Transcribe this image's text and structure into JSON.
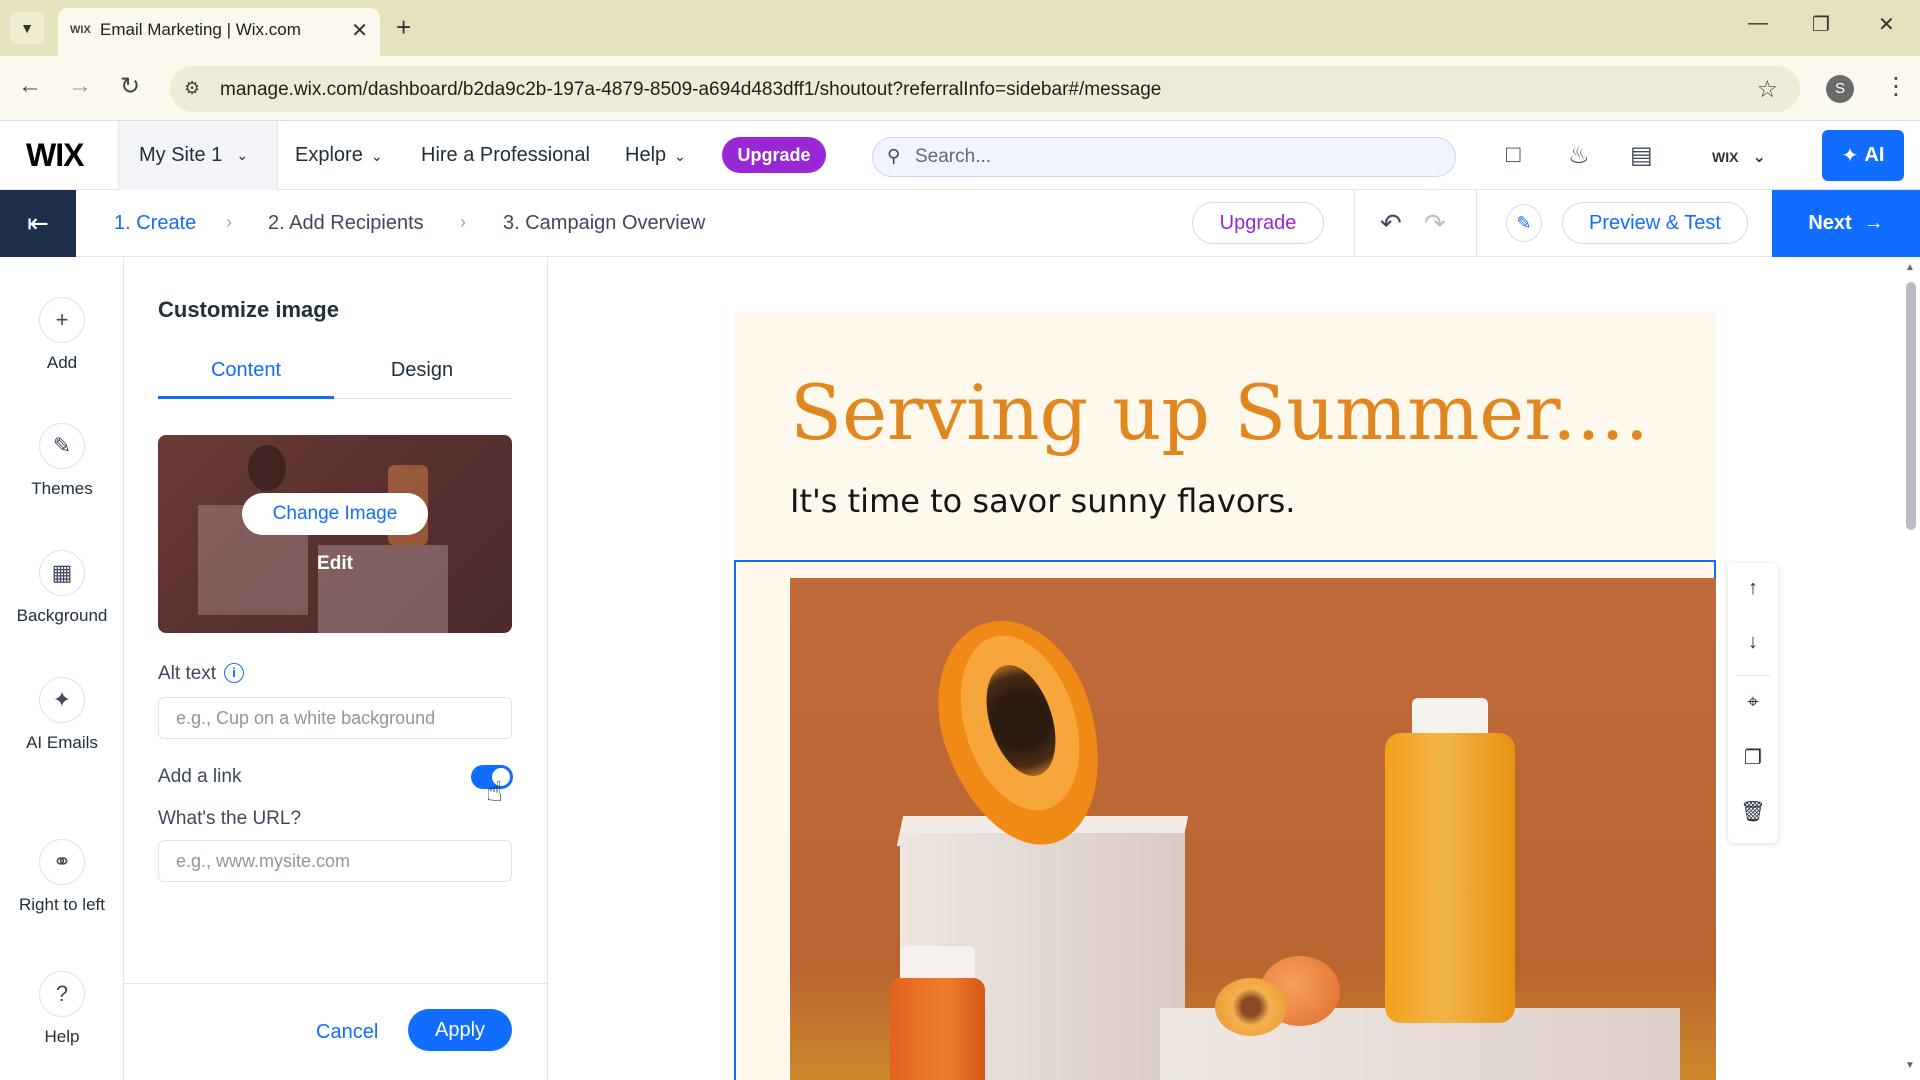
{
  "browser": {
    "tab_title": "Email Marketing | Wix.com",
    "tab_favicon": "WIX",
    "url": "manage.wix.com/dashboard/b2da9c2b-197a-4879-8509-a694d483dff1/shoutout?referralInfo=sidebar#/message",
    "profile_initial": "S"
  },
  "wix_bar": {
    "logo": "WIX",
    "site_name": "My Site 1",
    "nav": {
      "explore": "Explore",
      "hire": "Hire a Professional",
      "help": "Help"
    },
    "upgrade_label": "Upgrade",
    "search_placeholder": "Search...",
    "account_logo": "WIX",
    "ai_label": "AI"
  },
  "steps": {
    "items": [
      "1. Create",
      "2. Add Recipients",
      "3. Campaign Overview"
    ],
    "upgrade_label": "Upgrade",
    "preview_label": "Preview & Test",
    "next_label": "Next"
  },
  "rail": {
    "items": [
      {
        "label": "Add",
        "icon": "plus-icon"
      },
      {
        "label": "Themes",
        "icon": "brush-icon"
      },
      {
        "label": "Background",
        "icon": "background-icon"
      },
      {
        "label": "AI Emails",
        "icon": "sparkle-icon"
      },
      {
        "label": "Right to left",
        "icon": "globe-icon"
      },
      {
        "label": "Help",
        "icon": "question-icon"
      }
    ]
  },
  "panel": {
    "title": "Customize image",
    "tabs": [
      "Content",
      "Design"
    ],
    "active_tab": "Content",
    "change_image_label": "Change Image",
    "edit_label": "Edit",
    "alt_text_label": "Alt text",
    "alt_text_placeholder": "e.g., Cup on a white background",
    "add_link_label": "Add a link",
    "add_link_on": true,
    "url_label": "What's the URL?",
    "url_placeholder": "e.g., www.mysite.com",
    "cancel_label": "Cancel",
    "apply_label": "Apply"
  },
  "email": {
    "headline": "Serving up Summer....",
    "subhead": "It's time to savor sunny flavors."
  },
  "colors": {
    "accent": "#116dff",
    "upgrade_purple": "#9a27d5",
    "headline_orange": "#e0871f",
    "email_bg": "#fff8ec"
  }
}
